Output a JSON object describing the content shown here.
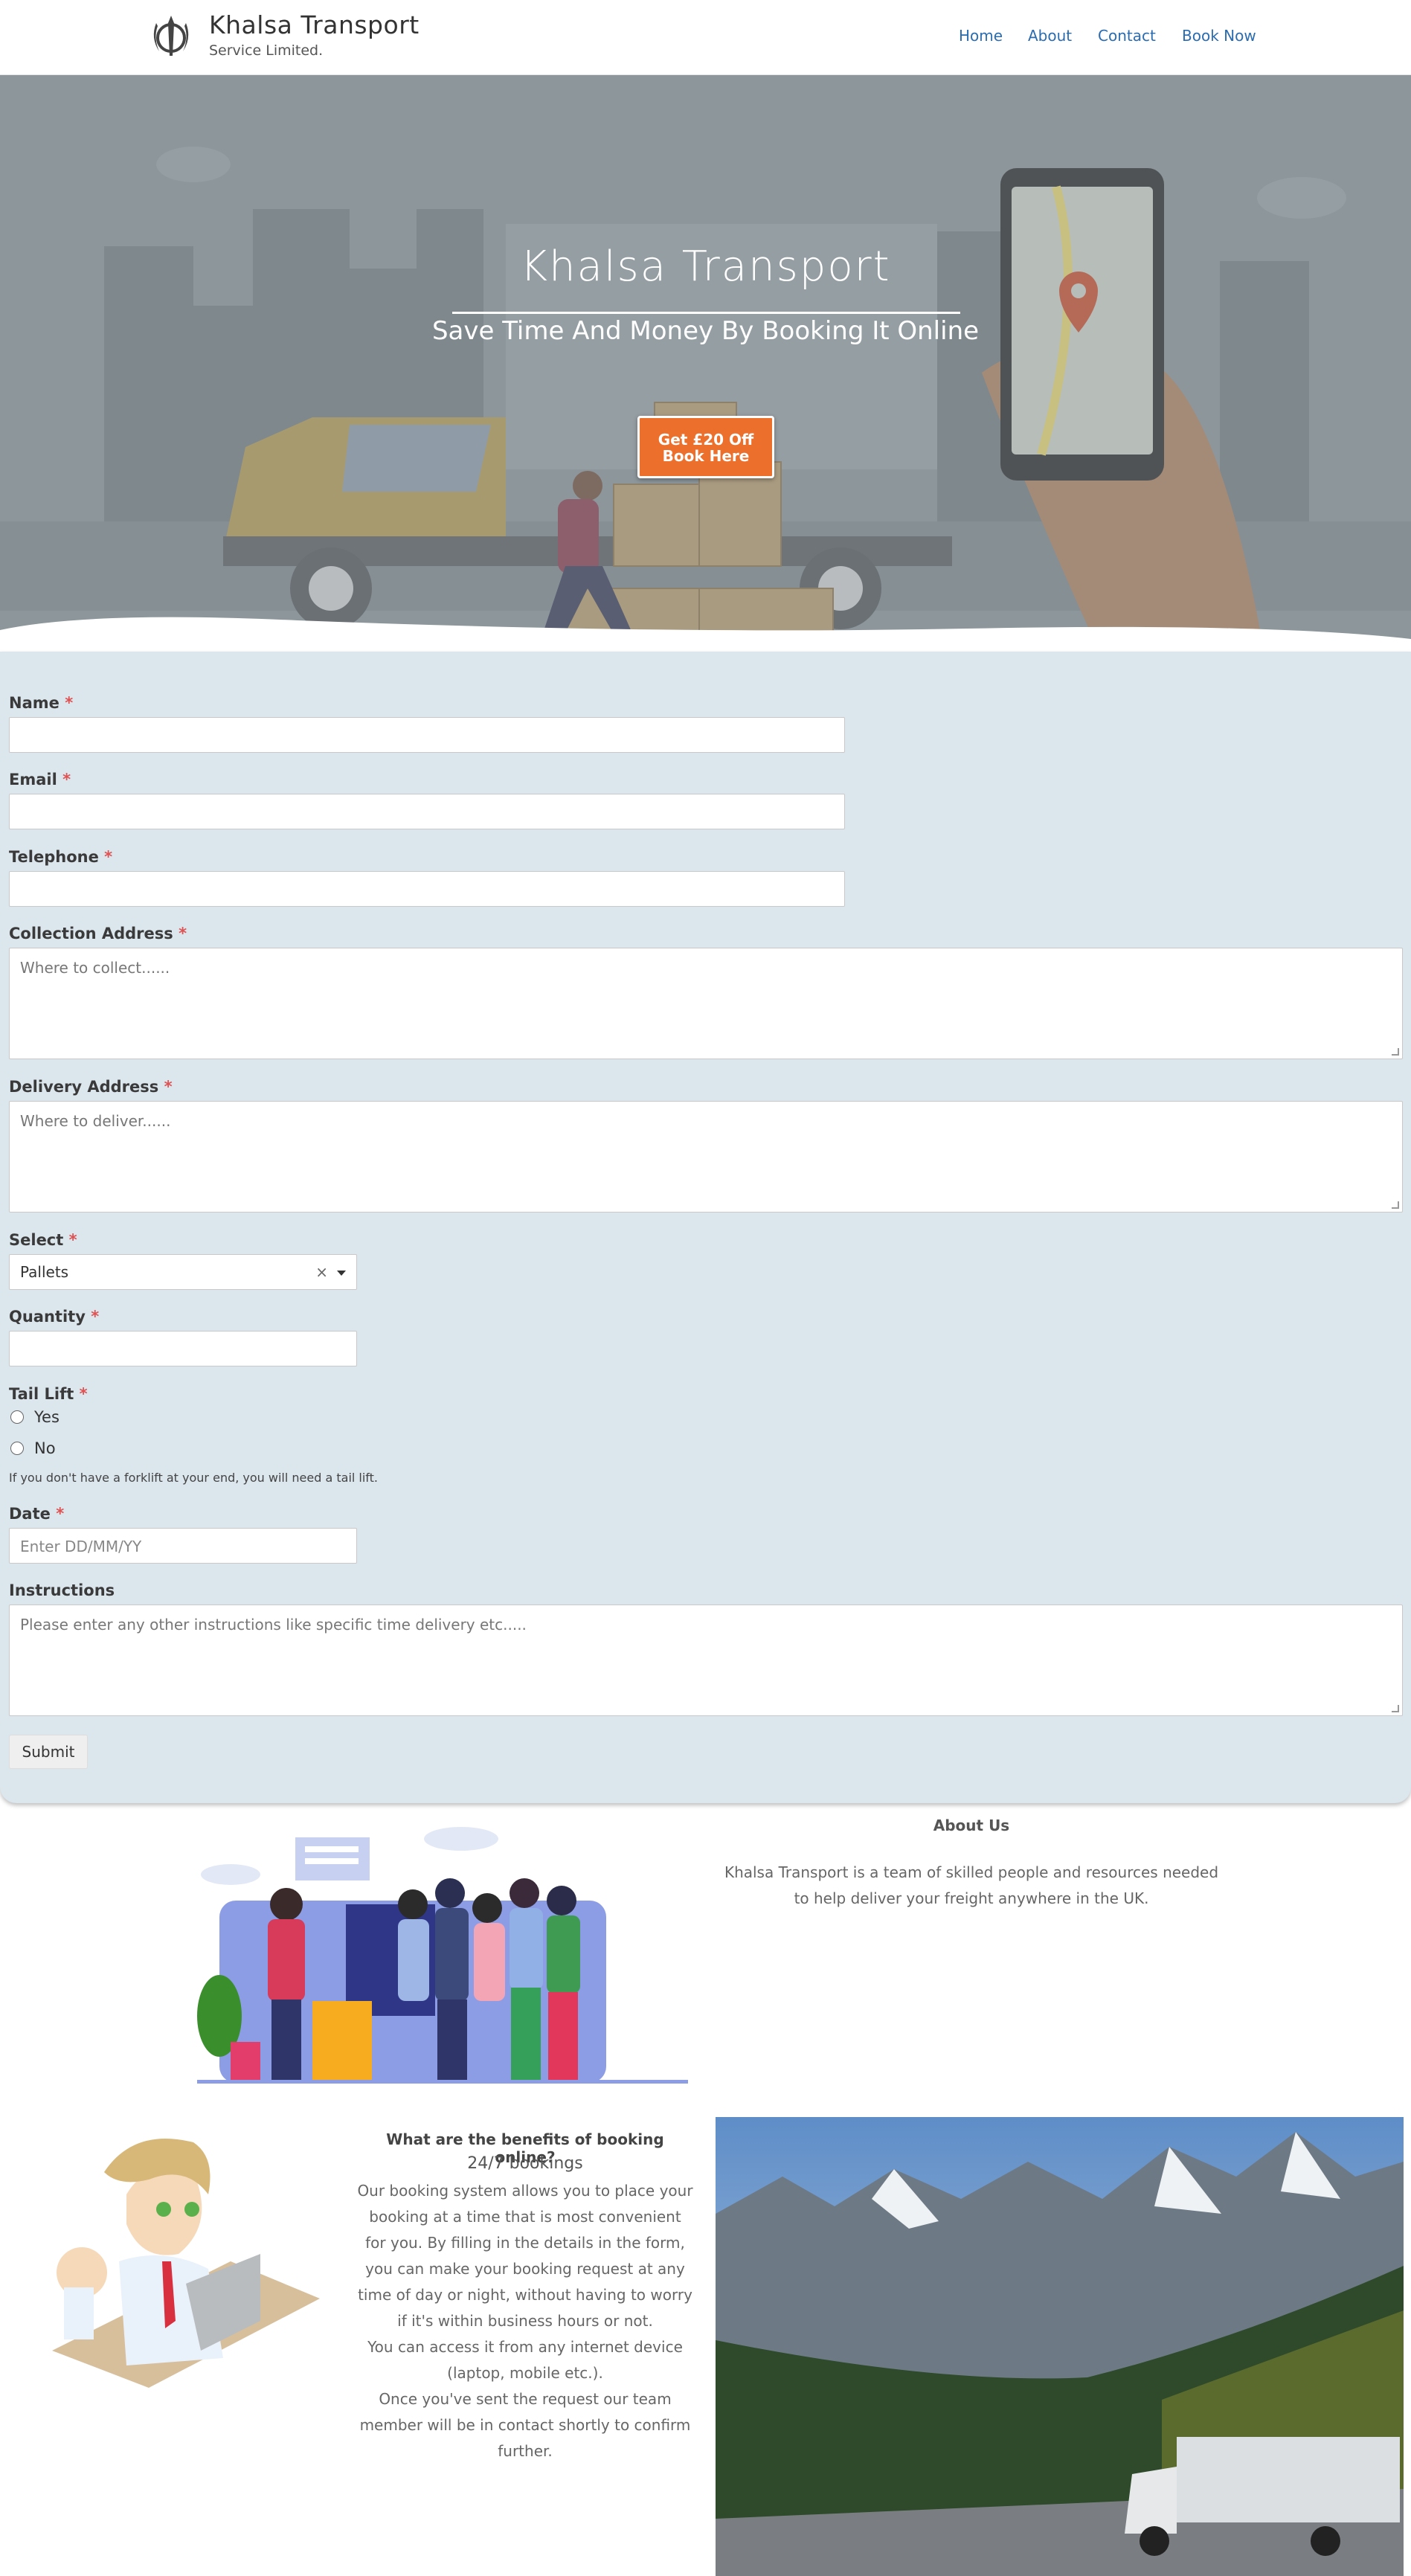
{
  "header": {
    "brand_title": "Khalsa Transport",
    "brand_subtitle": "Service Limited.",
    "logo_icon": "khanda-icon",
    "nav": [
      "Home",
      "About",
      "Contact",
      "Book Now"
    ]
  },
  "hero": {
    "title": "Khalsa Transport",
    "subtitle": "Save Time And Money By Booking It Online",
    "cta_line1": "Get £20 Off",
    "cta_line2": "Book Here"
  },
  "form": {
    "name_label": "Name",
    "email_label": "Email",
    "telephone_label": "Telephone",
    "collection_label": "Collection Address",
    "collection_placeholder": "Where to collect......",
    "delivery_label": "Delivery Address",
    "delivery_placeholder": "Where to deliver......",
    "select_label": "Select",
    "select_value": "Pallets",
    "quantity_label": "Quantity",
    "taillift_label": "Tail Lift",
    "taillift_options": [
      "Yes",
      "No"
    ],
    "taillift_help": "If you don't have a forklift at your end, you will need a tail lift.",
    "date_label": "Date",
    "date_placeholder": "Enter DD/MM/YY",
    "instructions_label": "Instructions",
    "instructions_placeholder": "Please enter any other instructions like specific time delivery etc.....",
    "required_mark": "*",
    "clear_symbol": "×",
    "submit_label": "Submit"
  },
  "about": {
    "title": "About Us",
    "text": "Khalsa Transport is a team of skilled people  and resources needed to help deliver your freight anywhere in the UK."
  },
  "benefits": {
    "title": "What are the benefits of booking online?",
    "subtitle": "24/7 bookings",
    "text": "Our booking system  allows you to place your booking at a time that is most convenient for you. By filling in the details in the form, you can make your booking request at any time of day or night, without having to worry if it's within business hours or not.",
    "text2": "You can access it from any internet device (laptop, mobile etc.).",
    "text3": "Once you've sent the request our team member will be in contact shortly to confirm further."
  },
  "colors": {
    "nav_link": "#2b6cb0",
    "cta_orange": "#ec6f2b",
    "form_bg": "#dbe6ed",
    "required": "#e05252"
  }
}
